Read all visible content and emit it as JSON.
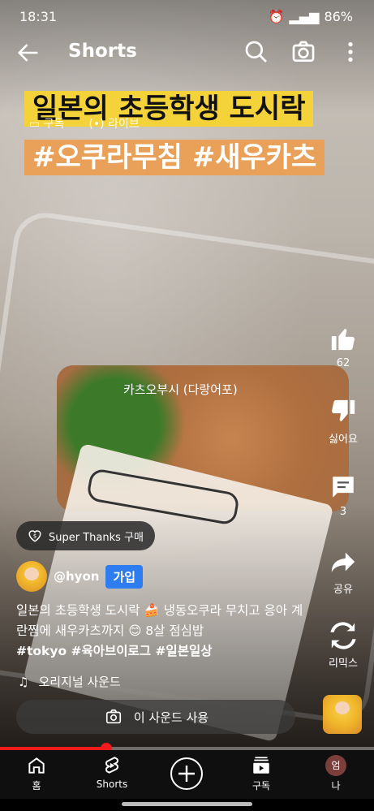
{
  "status": {
    "time": "18:31",
    "battery": "86%"
  },
  "appbar": {
    "title": "Shorts"
  },
  "overlay_tabs": {
    "subscriptions": "구독",
    "live": "라이브"
  },
  "video": {
    "caption_line1": "일본의 초등학생 도시락",
    "caption_line2": "#오쿠라무침 #새우카츠",
    "food_label": "카츠오부시 (다랑어포)"
  },
  "actions": {
    "like_count": "62",
    "dislike_label": "싫어요",
    "comment_count": "3",
    "share_label": "공유",
    "remix_label": "리믹스"
  },
  "super_thanks": {
    "label": "Super Thanks 구매"
  },
  "channel": {
    "handle": "@hyon",
    "join_label": "가입"
  },
  "description": {
    "text": "일본의 초등학생 도시락 🍰 냉동오쿠라 무치고 응아 계란찜에 새우카츠까지 😊 8살 점심밥",
    "hashtags": "#tokyo #육아브이로그 #일본일상"
  },
  "sound": {
    "name": "오리지널 사운드",
    "use_label": "이 사운드 사용"
  },
  "progress": {
    "fraction": 0.285
  },
  "nav": {
    "home": "홈",
    "shorts": "Shorts",
    "subscriptions": "구독",
    "me": "나",
    "me_avatar_letter": "엄"
  },
  "colors": {
    "accent": "#f21a1a",
    "join": "#2d7cf0"
  }
}
